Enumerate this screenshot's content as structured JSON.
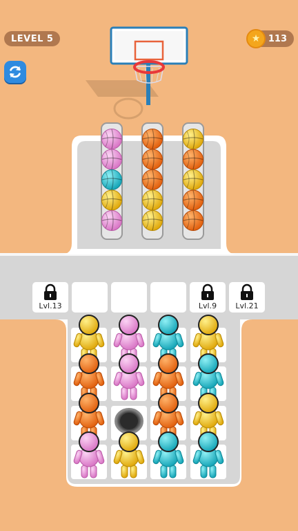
{
  "hud": {
    "level_label": "LEVEL 5",
    "coin_count": "113"
  },
  "colors": {
    "background": "#f3b77f",
    "road": "#d6d6d6",
    "board": "#ffffff",
    "pink": "#ee9be0",
    "orange": "#f27a1f",
    "cyan": "#2cc6d4",
    "yellow": "#f2c41a"
  },
  "icons": [
    "refresh-icon",
    "coin-icon",
    "lock-icon",
    "basketball-hoop-icon"
  ],
  "ball_tubes": [
    [
      "pink",
      "pink",
      "cyan",
      "yellow",
      "pink"
    ],
    [
      "orange",
      "orange",
      "orange",
      "yellow",
      "yellow"
    ],
    [
      "yellow",
      "orange",
      "yellow",
      "orange",
      "orange"
    ]
  ],
  "slots": [
    {
      "locked": true,
      "label": "Lvl.13"
    },
    {
      "locked": false,
      "label": ""
    },
    {
      "locked": false,
      "label": ""
    },
    {
      "locked": false,
      "label": ""
    },
    {
      "locked": true,
      "label": "Lvl.9"
    },
    {
      "locked": true,
      "label": "Lvl.21"
    }
  ],
  "crowd_grid": [
    [
      "yellow",
      "pink",
      "cyan",
      "yellow"
    ],
    [
      "orange",
      "pink",
      "orange",
      "cyan"
    ],
    [
      "orange",
      "empty",
      "orange",
      "yellow"
    ],
    [
      "pink",
      "yellow",
      "cyan",
      "cyan"
    ]
  ],
  "hole_position": {
    "row": 2,
    "col": 1
  }
}
